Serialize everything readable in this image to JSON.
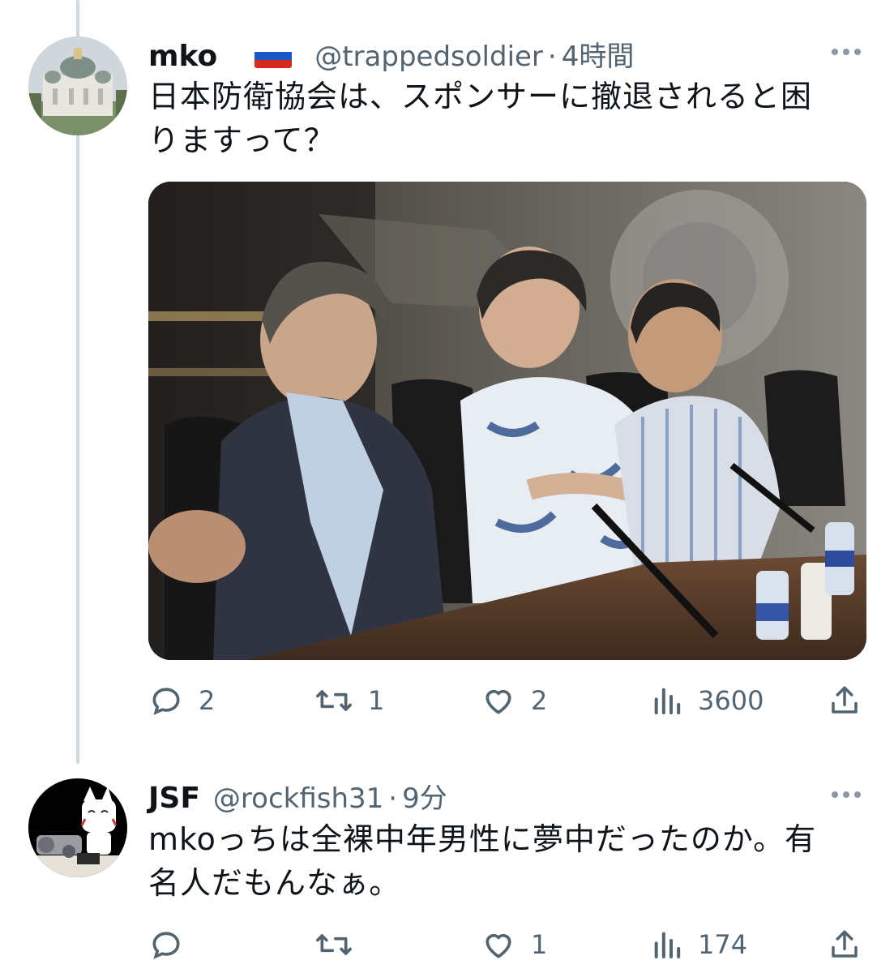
{
  "tweet1": {
    "name": "mko",
    "handle": "@trappedsoldier",
    "separator": "·",
    "time": "4時間",
    "text_line1": "日本防衛協会は、スポンサーに撤退されると困",
    "text_line2": "りますって？",
    "media_icon": "photo-of-men-seated-at-conference-table",
    "stats": {
      "replies": "2",
      "retweets": "1",
      "likes": "2",
      "views": "3600"
    }
  },
  "tweet2": {
    "name": "JSF",
    "handle": "@rockfish31",
    "separator": "·",
    "time": "9分",
    "text_line1": "mkoっちは全裸中年男性に夢中だったのか。有",
    "text_line2": "名人だもんなぁ。",
    "stats": {
      "replies": "",
      "retweets": "",
      "likes": "1",
      "views": "174"
    }
  },
  "colors": {
    "text": "#0f1419",
    "secondary": "#536471",
    "thread_line": "#cfd9de"
  }
}
